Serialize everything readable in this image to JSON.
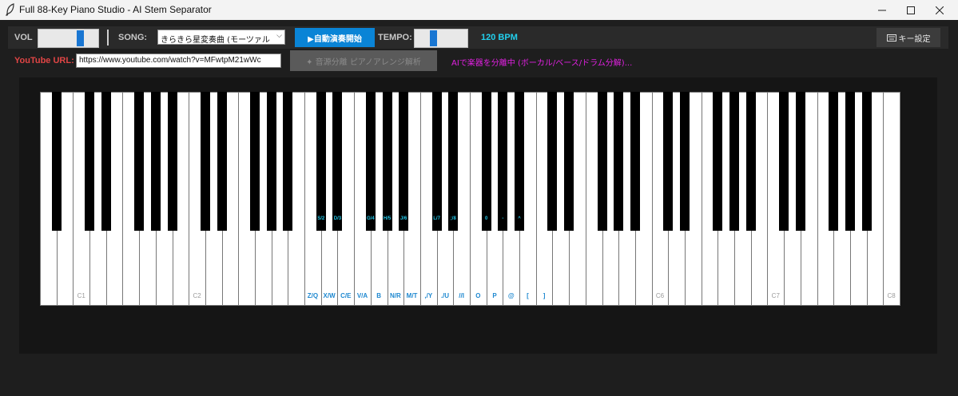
{
  "window": {
    "title": "Full 88-Key Piano Studio - AI Stem Separator"
  },
  "toolbar": {
    "vol_label": "VOL",
    "volume": 0.75,
    "song_label": "SONG:",
    "song_selected": "きらきら星変奏曲 (モーツァルト)",
    "auto_play_button": "▶自動演奏開始",
    "tempo_label": "TEMPO:",
    "tempo_level": 0.35,
    "tempo_value": "120 BPM",
    "key_settings_button": "キー設定"
  },
  "row2": {
    "youtube_label": "YouTube URL:",
    "youtube_url": "https://www.youtube.com/watch?v=MFwtpM21wWc",
    "separate_button": "✦ 音源分離 ピアノアレンジ解析",
    "status_text": "AIで楽器を分離中 (ボーカル/ベース/ドラム分解)..."
  },
  "piano": {
    "white_key_count": 52,
    "octave_labels": {
      "2": "C1",
      "9": "C2",
      "37": "C6",
      "44": "C7",
      "51": "C8"
    },
    "white_key_labels": {
      "16": "Z/Q",
      "17": "X/W",
      "18": "C/E",
      "19": "V/A",
      "20": "B",
      "21": "N/R",
      "22": "M/T",
      "23": ",/Y",
      "24": "./U",
      "25": "//I",
      "26": "O",
      "27": "P",
      "28": "@",
      "29": "[",
      "30": "]"
    },
    "black_key_labels": {
      "16": "S/2",
      "17": "D/3",
      "19": "G/4",
      "20": "H/5",
      "21": "J/6",
      "23": "L/7",
      "24": ";/8",
      "26": "0",
      "27": "-",
      "28": "^"
    }
  },
  "colors": {
    "accent": "#0a84d6",
    "bpm": "#22d0ee",
    "youtube_label": "#e04545",
    "status": "#e020e0",
    "key_label": "#1e88d0"
  }
}
